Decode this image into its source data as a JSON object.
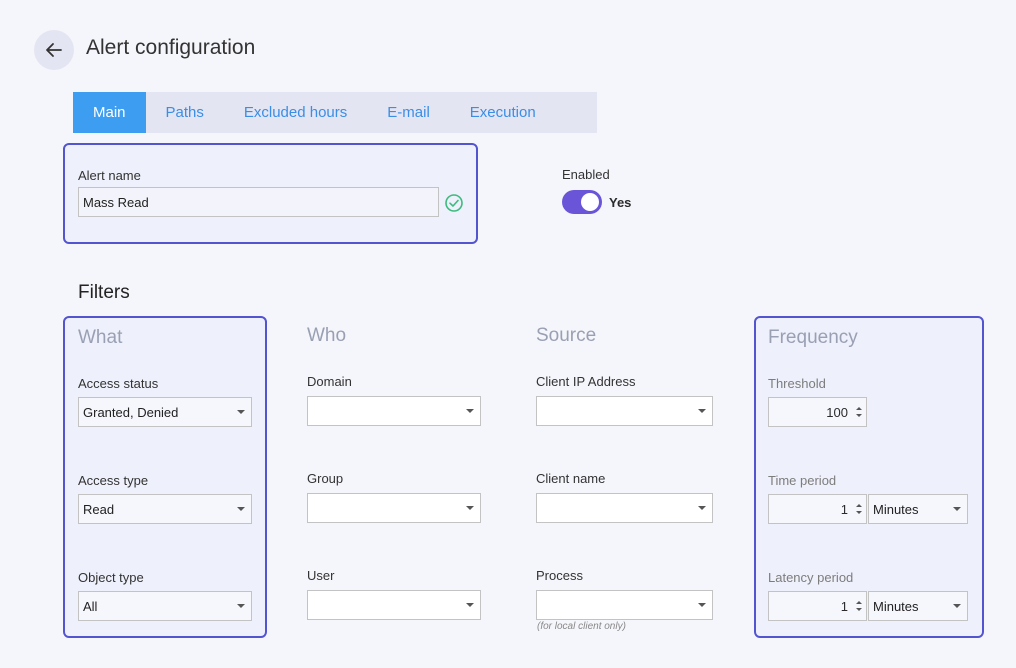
{
  "header": {
    "title": "Alert configuration"
  },
  "tabs": [
    {
      "label": "Main",
      "active": true
    },
    {
      "label": "Paths"
    },
    {
      "label": "Excluded hours"
    },
    {
      "label": "E-mail"
    },
    {
      "label": "Execution"
    }
  ],
  "alert": {
    "name_label": "Alert name",
    "name_value": "Mass Read"
  },
  "enabled": {
    "label": "Enabled",
    "value": "Yes",
    "on": true
  },
  "filters": {
    "title": "Filters",
    "what": {
      "heading": "What",
      "access_status_label": "Access status",
      "access_status_value": "Granted, Denied",
      "access_type_label": "Access type",
      "access_type_value": "Read",
      "object_type_label": "Object type",
      "object_type_value": "All"
    },
    "who": {
      "heading": "Who",
      "domain_label": "Domain",
      "group_label": "Group",
      "user_label": "User"
    },
    "source": {
      "heading": "Source",
      "client_ip_label": "Client IP Address",
      "client_name_label": "Client name",
      "process_label": "Process",
      "process_note": "(for local client only)"
    },
    "frequency": {
      "heading": "Frequency",
      "threshold_label": "Threshold",
      "threshold_value": "100",
      "time_period_label": "Time period",
      "time_period_value": "1",
      "time_period_unit": "Minutes",
      "latency_label": "Latency period",
      "latency_value": "1",
      "latency_unit": "Minutes"
    }
  },
  "colors": {
    "accent": "#5354d0",
    "tab_active": "#3d9ef1",
    "toggle": "#6a55d8",
    "check": "#3dbb7e"
  }
}
